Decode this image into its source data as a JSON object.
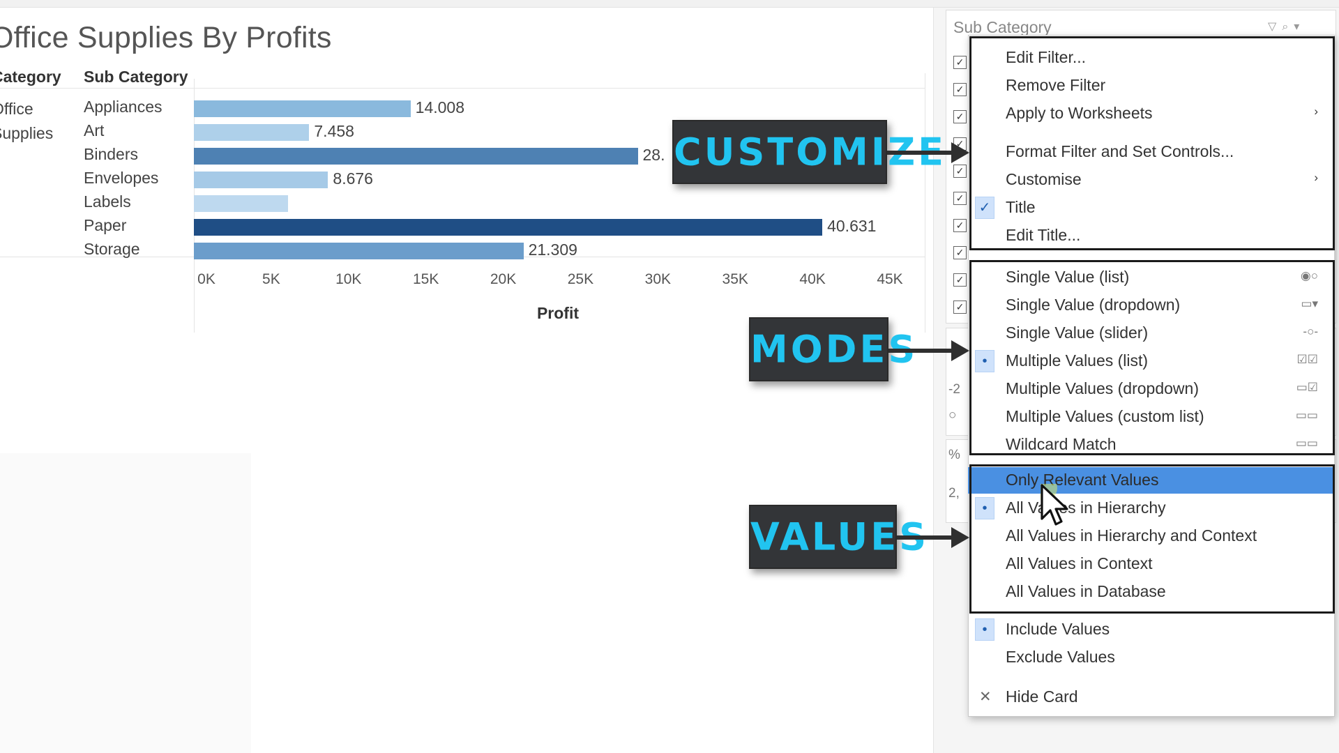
{
  "sheet": {
    "title": "Office Supplies By Profits",
    "headers": {
      "category": "Category",
      "sub_category": "Sub Category"
    },
    "category_lines": [
      "Office",
      "Supplies"
    ],
    "axis_title": "Profit"
  },
  "chart_data": {
    "type": "bar",
    "orientation": "horizontal",
    "title": "Office Supplies By Profits",
    "xlabel": "Profit",
    "ylabel": "Sub Category",
    "categories": [
      "Appliances",
      "Art",
      "Binders",
      "Envelopes",
      "Labels",
      "Paper",
      "Storage"
    ],
    "values": [
      14008,
      7458,
      28700,
      8676,
      6100,
      40631,
      21309
    ],
    "value_labels": [
      "14.008",
      "7.458",
      "28.",
      "8.676",
      "",
      "40.631",
      "21.309"
    ],
    "bar_colors": [
      "#8ab9dd",
      "#aed0ea",
      "#4e81b3",
      "#a6cae7",
      "#bed9ef",
      "#1f4e85",
      "#6b9dcb"
    ],
    "xlim": [
      0,
      45000
    ],
    "ticks": [
      "0K",
      "5K",
      "10K",
      "15K",
      "20K",
      "25K",
      "30K",
      "35K",
      "40K",
      "45K"
    ],
    "grid": false,
    "legend": "none"
  },
  "filter_card": {
    "title": "Sub Category",
    "icons": [
      "filter-icon",
      "search-icon",
      "dropdown-icon"
    ],
    "check_count": 10,
    "lower_texts": [
      "-2",
      "%",
      "2,"
    ]
  },
  "menu": {
    "group_customize": [
      {
        "label": "Edit Filter..."
      },
      {
        "label": "Remove Filter"
      },
      {
        "label": "Apply to Worksheets",
        "submenu": true
      },
      {
        "label": "Format Filter and Set Controls..."
      },
      {
        "label": "Customise",
        "submenu": true
      },
      {
        "label": "Title",
        "checked": true
      },
      {
        "label": "Edit Title..."
      }
    ],
    "group_modes": [
      {
        "label": "Single Value (list)",
        "icon": "◉○"
      },
      {
        "label": "Single Value (dropdown)",
        "icon": "▭▾"
      },
      {
        "label": "Single Value (slider)",
        "icon": "-○-"
      },
      {
        "label": "Multiple Values (list)",
        "icon": "☑☑",
        "selected": true
      },
      {
        "label": "Multiple Values (dropdown)",
        "icon": "▭☑"
      },
      {
        "label": "Multiple Values (custom list)",
        "icon": "▭▭"
      },
      {
        "label": "Wildcard Match",
        "icon": "▭▭"
      }
    ],
    "group_values": [
      {
        "label": "Only Relevant Values",
        "highlighted": true
      },
      {
        "label": "All Values in Hierarchy",
        "selected": true
      },
      {
        "label": "All Values in Hierarchy and Context"
      },
      {
        "label": "All Values in Context"
      },
      {
        "label": "All Values in Database"
      }
    ],
    "group_include": [
      {
        "label": "Include Values",
        "selected": true
      },
      {
        "label": "Exclude Values"
      }
    ],
    "hide_card": "Hide Card",
    "submenu_arrow": "›",
    "check_mark": "✓",
    "bullet": "•",
    "close_mark": "✕"
  },
  "callouts": {
    "customize": "CUSTOMIZE",
    "modes": "MODES",
    "values": "VALUES"
  },
  "colors": {
    "callout_bg": "#333538",
    "callout_text": "#21c4f0",
    "menu_highlight": "#4a90e2",
    "menu_mark_bg": "#cfe2fb"
  }
}
